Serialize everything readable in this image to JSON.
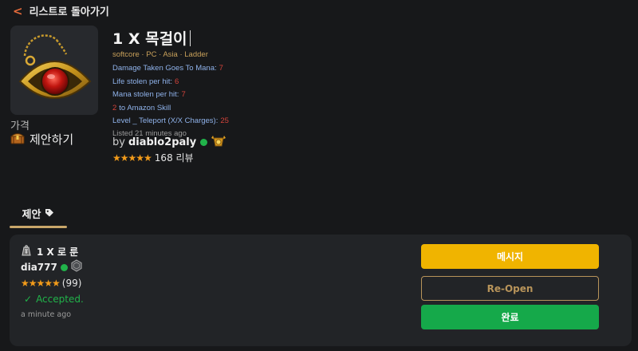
{
  "nav": {
    "back_label": "리스트로 돌아가기"
  },
  "item": {
    "title": "1 X 목걸이",
    "meta": "softcore · PC · Asia · Ladder",
    "properties": [
      {
        "label": "Damage Taken Goes To Mana:",
        "value": "7"
      },
      {
        "label": "Life stolen per hit:",
        "value": "6"
      },
      {
        "label": "Mana stolen per hit:",
        "value": "7"
      }
    ],
    "skill": {
      "value": "2",
      "label": "to Amazon Skill"
    },
    "charges": {
      "label": "Level _ Teleport (X/X Charges):",
      "value": "25"
    },
    "listed": "Listed 21 minutes ago",
    "price_label": "가격",
    "offer_link": "제안하기"
  },
  "seller": {
    "by": "by",
    "name": "diablo2paly",
    "online": true,
    "stars": "★★★★★",
    "reviews": "168 리뷰"
  },
  "tabs": [
    {
      "label": "제안"
    }
  ],
  "offer": {
    "title": "1 X 로 룬",
    "buyer_name": "dia777",
    "stars": "★★★★★",
    "reviews": "(99)",
    "status_icon": "✓",
    "status": "Accepted.",
    "time": "a minute ago",
    "actions": {
      "message": "메시지",
      "reopen": "Re-Open",
      "complete": "완료"
    }
  },
  "colors": {
    "accent_orange": "#e26a3b",
    "gold": "#c8a66a",
    "property_blue": "#8fb2ea",
    "value_red": "#d4433b",
    "online_green": "#21b34a",
    "message_yellow": "#f0b400",
    "complete_green": "#15a94a"
  }
}
